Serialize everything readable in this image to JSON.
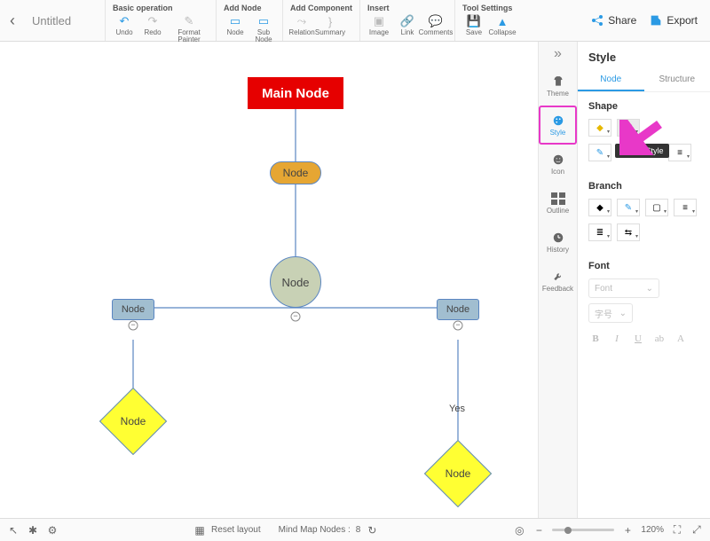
{
  "document": {
    "title": "Untitled"
  },
  "toolbar": {
    "groups": [
      {
        "title": "Basic operation",
        "items": [
          {
            "name": "undo",
            "label": "Undo",
            "color": "#2b9ae4"
          },
          {
            "name": "redo",
            "label": "Redo",
            "color": "#bbb"
          },
          {
            "name": "format-painter",
            "label": "Format Painter",
            "color": "#bbb",
            "wide": true
          }
        ]
      },
      {
        "title": "Add Node",
        "items": [
          {
            "name": "node",
            "label": "Node",
            "color": "#2b9ae4"
          },
          {
            "name": "sub-node",
            "label": "Sub Node",
            "color": "#2b9ae4"
          }
        ]
      },
      {
        "title": "Add Component",
        "items": [
          {
            "name": "relation",
            "label": "Relation",
            "color": "#bbb"
          },
          {
            "name": "summary",
            "label": "Summary",
            "color": "#bbb"
          }
        ]
      },
      {
        "title": "Insert",
        "items": [
          {
            "name": "image",
            "label": "Image",
            "color": "#bbb"
          },
          {
            "name": "link",
            "label": "Link",
            "color": "#bbb"
          },
          {
            "name": "comments",
            "label": "Comments",
            "color": "#bbb"
          }
        ]
      },
      {
        "title": "Tool Settings",
        "items": [
          {
            "name": "save",
            "label": "Save",
            "color": "#bbb"
          },
          {
            "name": "collapse",
            "label": "Collapse",
            "color": "#2b9ae4"
          }
        ]
      }
    ],
    "share": "Share",
    "export": "Export"
  },
  "rail": {
    "items": [
      {
        "name": "theme",
        "label": "Theme"
      },
      {
        "name": "style",
        "label": "Style",
        "active": true
      },
      {
        "name": "icon",
        "label": "Icon"
      },
      {
        "name": "outline",
        "label": "Outline"
      },
      {
        "name": "history",
        "label": "History"
      },
      {
        "name": "feedback",
        "label": "Feedback"
      }
    ]
  },
  "panel": {
    "title": "Style",
    "tabs": [
      {
        "name": "node",
        "label": "Node",
        "active": true
      },
      {
        "name": "structure",
        "label": "Structure",
        "active": false
      }
    ],
    "shape": {
      "title": "Shape",
      "tooltip": "Shape Style"
    },
    "branch": {
      "title": "Branch"
    },
    "font": {
      "title": "Font",
      "font_placeholder": "Font",
      "size_placeholder": "字号"
    }
  },
  "diagram": {
    "main_node": "Main Node",
    "node_label": "Node",
    "yes_label": "Yes"
  },
  "statusbar": {
    "reset_layout": "Reset layout",
    "nodes_label": "Mind Map Nodes :",
    "nodes_count": "8",
    "zoom": "120%"
  }
}
